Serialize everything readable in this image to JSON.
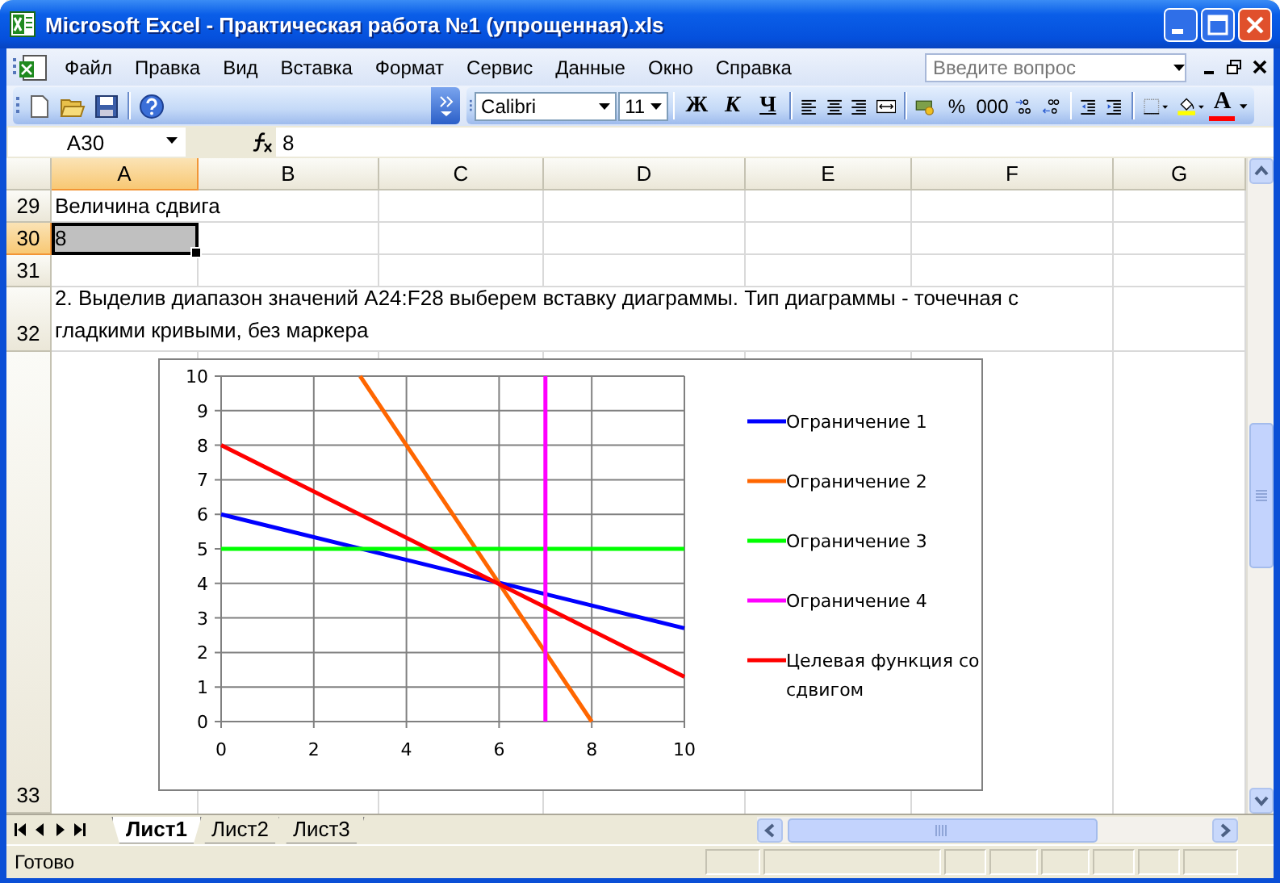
{
  "window": {
    "title": "Microsoft Excel - Практическая работа №1 (упрощенная).xls"
  },
  "menu": {
    "items": [
      "Файл",
      "Правка",
      "Вид",
      "Вставка",
      "Формат",
      "Сервис",
      "Данные",
      "Окно",
      "Справка"
    ],
    "help_search": {
      "placeholder": "Введите вопрос"
    }
  },
  "toolbar": {
    "font": "Calibri",
    "font_size": "11",
    "bold": "Ж",
    "italic": "К",
    "underline": "Ч",
    "percent": "%",
    "thousands": "000",
    "font_color": "A"
  },
  "formula_bar": {
    "name_box": "A30",
    "value": "8"
  },
  "sheet": {
    "columns": [
      {
        "label": "A",
        "selected": true
      },
      {
        "label": "B",
        "selected": false
      },
      {
        "label": "C",
        "selected": false
      },
      {
        "label": "D",
        "selected": false
      },
      {
        "label": "E",
        "selected": false
      },
      {
        "label": "F",
        "selected": false
      },
      {
        "label": "G",
        "selected": false
      }
    ],
    "rows": [
      {
        "number": "29",
        "selected": false,
        "text": "Величина сдвига",
        "wrapped": false
      },
      {
        "number": "30",
        "selected": true,
        "text": "8",
        "wrapped": false
      },
      {
        "number": "31",
        "selected": false
      },
      {
        "number": "32",
        "selected": false,
        "text": "2. Выделив диапазон значений A24:F28 выберем вставку диаграммы. Тип диаграммы - точечная с гладкими кривыми, без маркера",
        "wrapped": true
      },
      {
        "number": "33",
        "selected": false
      }
    ],
    "chart": {
      "chart_data": {
        "type": "line",
        "grid": true,
        "legend": true,
        "xlim": [
          0,
          10
        ],
        "ylim": [
          0,
          10
        ],
        "xticks": [
          0,
          2,
          4,
          6,
          8,
          10
        ],
        "yticks": [
          0,
          1,
          2,
          3,
          4,
          5,
          6,
          7,
          8,
          9,
          10
        ],
        "series": [
          {
            "name": "Ограничение 1",
            "color": "#0000ff",
            "x": [
              0,
              10
            ],
            "values": [
              6,
              2.7
            ]
          },
          {
            "name": "Ограничение 2",
            "color": "#ff6600",
            "x": [
              3,
              8
            ],
            "values": [
              10,
              0
            ]
          },
          {
            "name": "Ограничение 3",
            "color": "#00ff00",
            "x": [
              0,
              10
            ],
            "values": [
              5,
              5
            ]
          },
          {
            "name": "Ограничение 4",
            "color": "#ff00ff",
            "x": [
              7,
              7
            ],
            "values": [
              0,
              10
            ]
          },
          {
            "name": "Целевая функция со сдвигом",
            "color": "#ff0000",
            "x": [
              0,
              10
            ],
            "values": [
              8,
              1.3
            ]
          }
        ]
      }
    }
  },
  "sheet_tabs": [
    {
      "label": "Лист1",
      "selected": true
    },
    {
      "label": "Лист2",
      "selected": false
    },
    {
      "label": "Лист3",
      "selected": false
    }
  ],
  "status_bar": {
    "text": "Готово"
  }
}
